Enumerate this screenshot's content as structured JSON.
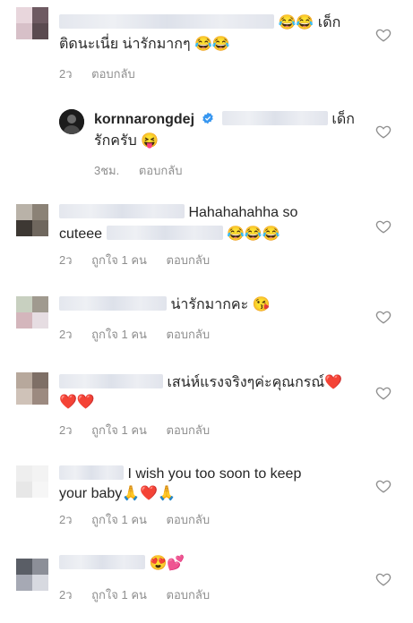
{
  "comments": [
    {
      "line1_end": "😂😂 เด็ก",
      "line2": "ติดนะเนี่ย น่ารักมากๆ 😂😂",
      "time": "2ว",
      "reply": "ตอบกลับ"
    },
    {
      "username": "kornnarongdej",
      "line1_end": "เด็ก",
      "line2": "รักครับ 😝",
      "time": "3ชม.",
      "reply": "ตอบกลับ"
    },
    {
      "line1_end": "Hahahahahha so",
      "line2_start": "cuteee",
      "line2_end": "😂😂😂",
      "time": "2ว",
      "likes": "ถูกใจ 1 คน",
      "reply": "ตอบกลับ"
    },
    {
      "line1_end": "น่ารักมากคะ 😘",
      "time": "2ว",
      "likes": "ถูกใจ 1 คน",
      "reply": "ตอบกลับ"
    },
    {
      "line1_end": "เสน่ห์แรงจริงๆค่ะคุณกรณ์❤️",
      "line2": "❤️❤️",
      "time": "2ว",
      "likes": "ถูกใจ 1 คน",
      "reply": "ตอบกลับ"
    },
    {
      "line1_end": "I wish you too soon to keep",
      "line2": "your baby🙏❤️🙏",
      "time": "2ว",
      "likes": "ถูกใจ 1 คน",
      "reply": "ตอบกลับ"
    },
    {
      "line1_end": "😍💕",
      "time": "2ว",
      "likes": "ถูกใจ 1 คน",
      "reply": "ตอบกลับ"
    }
  ],
  "colors": {
    "text": "#262626",
    "meta": "#8e8e8e",
    "verified": "#3897f0",
    "heart_outline": "#8e8e8e"
  },
  "icons": {
    "like": "heart-outline-icon",
    "verified": "verified-badge-icon"
  }
}
